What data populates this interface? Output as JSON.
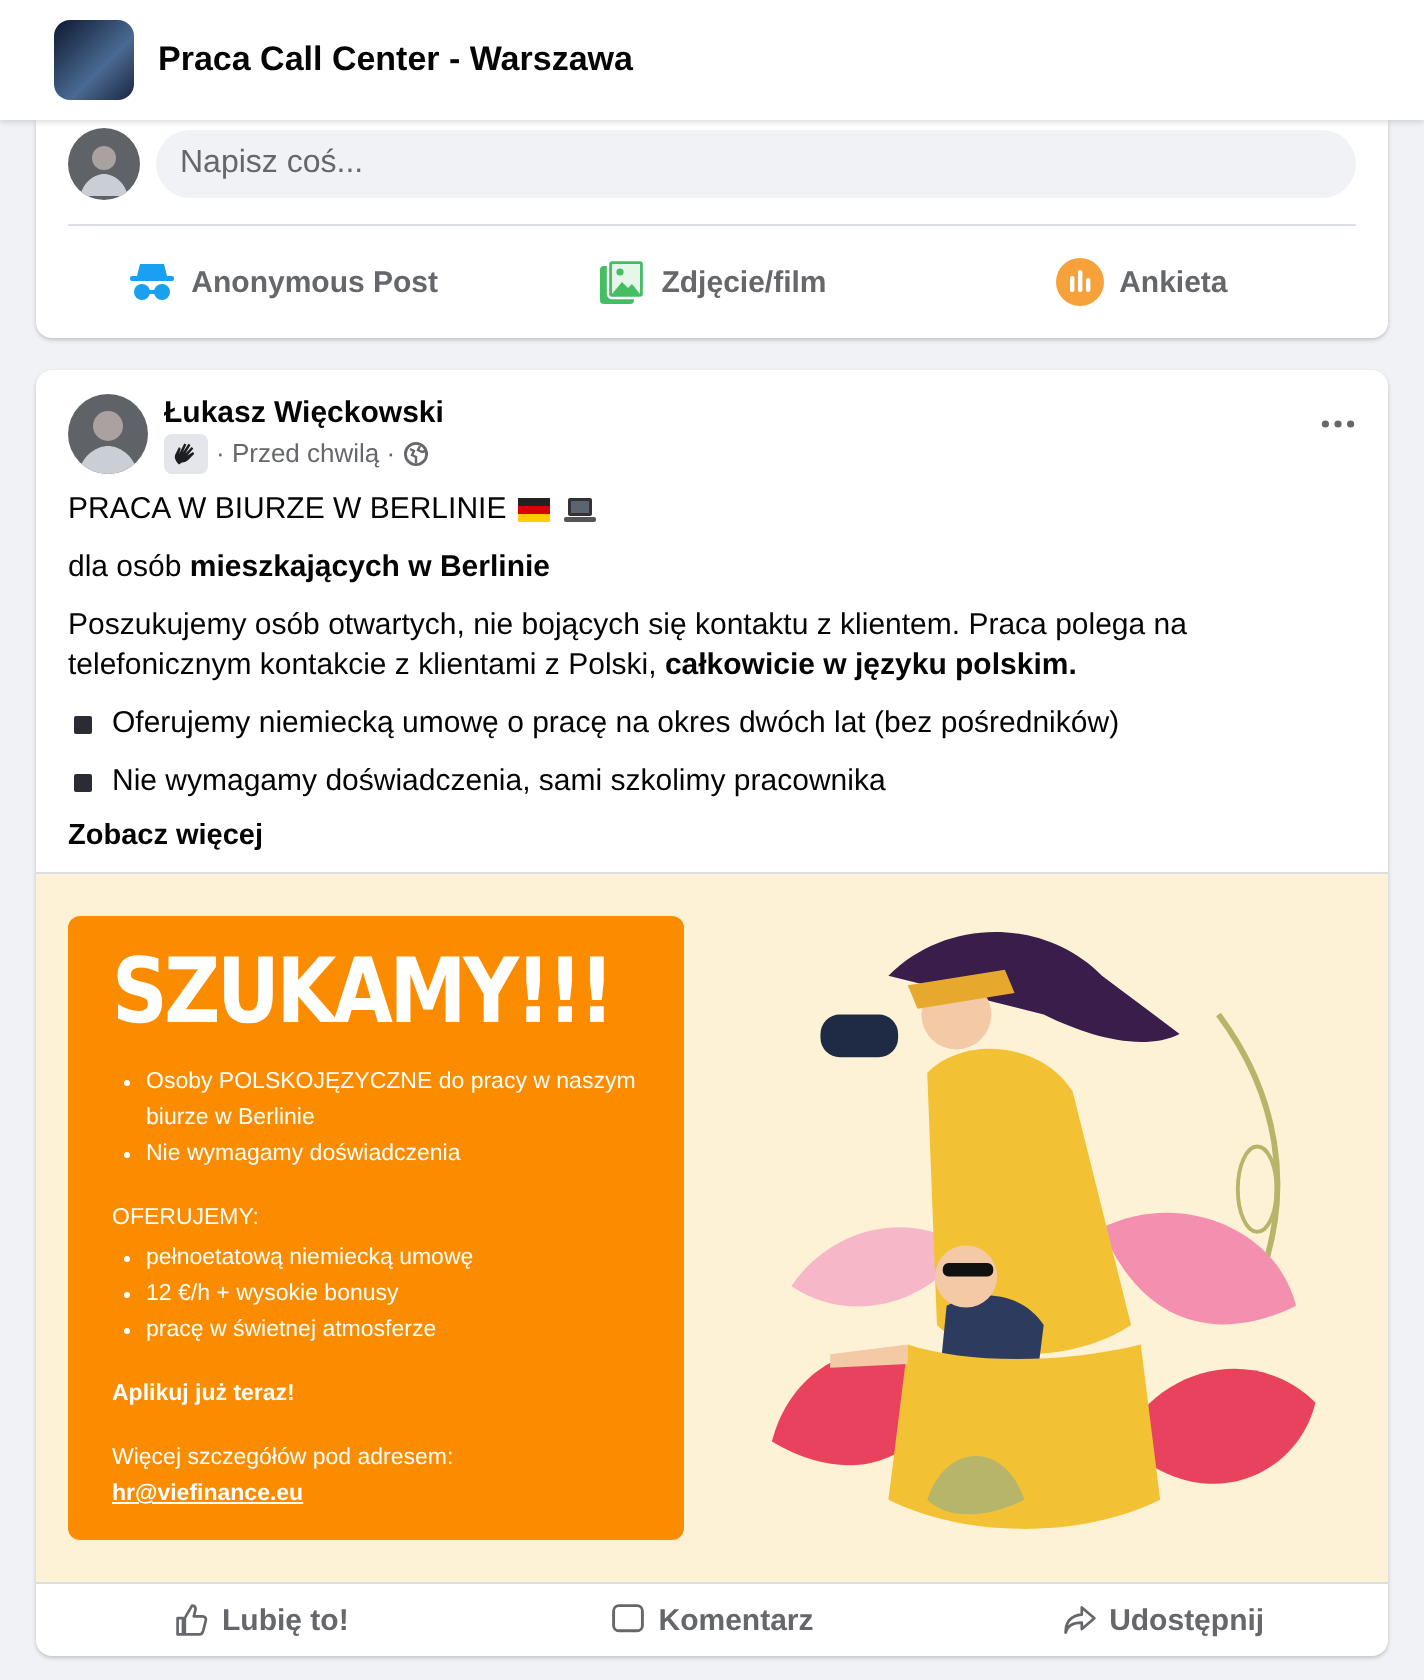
{
  "header": {
    "title": "Praca Call Center - Warszawa"
  },
  "composer": {
    "placeholder": "Napisz coś...",
    "actions": [
      {
        "kind": "anonymous",
        "label": "Anonymous Post"
      },
      {
        "kind": "photo",
        "label": "Zdjęcie/film"
      },
      {
        "kind": "poll",
        "label": "Ankieta"
      }
    ]
  },
  "post": {
    "author": "Łukasz Więckowski",
    "meta": "· Przed chwilą ·",
    "title": "PRACA W BIURZE W BERLINIE",
    "paragraphs": [
      "dla osób **mieszkających w Berlinie**",
      "Poszukujemy osób otwartych, nie bojących się kontaktu z klientem. Praca polega na telefonicznym kontakcie z klientami z Polski, **całkowicie w języku polskim.**"
    ],
    "bullets": [
      "Oferujemy niemiecką umowę o pracę na okres dwóch lat (bez pośredników)",
      "Nie wymagamy doświadczenia, sami szkolimy pracownika"
    ],
    "see_more": "Zobacz więcej",
    "graphic": {
      "headline": "SZUKAMY!!!",
      "bullets": [
        "Osoby POLSKOJĘZYCZNE do pracy w naszym biurze w Berlinie",
        "Nie wymagamy doświadczenia"
      ],
      "offer_title": "OFERUJEMY:",
      "offer_bullets": [
        "pełnoetatową niemiecką umowę",
        "12 €/h + wysokie bonusy",
        "pracę w świetnej atmosferze"
      ],
      "cta": "Aplikuj już teraz!",
      "details": "Więcej szczegółów pod adresem:",
      "email": "hr@viefinance.eu"
    },
    "actions": [
      {
        "kind": "like",
        "label": "Lubię to!"
      },
      {
        "kind": "comment",
        "label": "Komentarz"
      },
      {
        "kind": "share",
        "label": "Udostępnij"
      }
    ]
  }
}
